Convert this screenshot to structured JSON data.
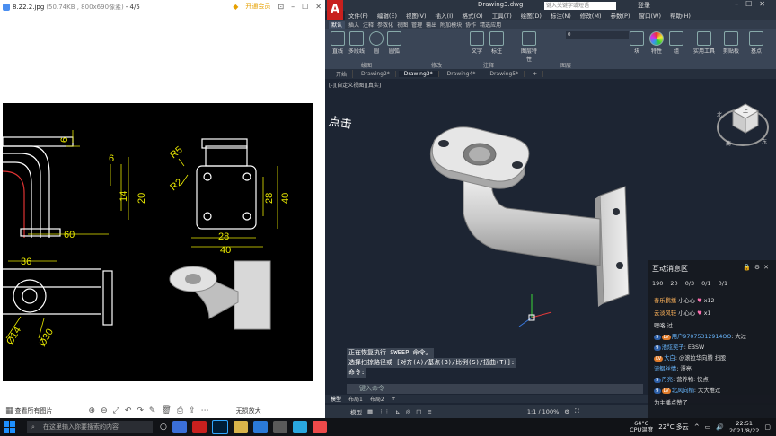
{
  "viewer": {
    "filename": "8.22.2.jpg",
    "meta": "(50.74KB , 800x690像素)",
    "page_counter": "- 4/5",
    "vip_label": "开通会员",
    "bottom_label": "查看所有图片",
    "bottom_right": "无损放大"
  },
  "drawing": {
    "dims": [
      "6",
      "6",
      "14",
      "20",
      "60",
      "R5",
      "R2",
      "28",
      "40",
      "28",
      "40",
      "36",
      "Ø14",
      "Ø30"
    ]
  },
  "acad": {
    "logo": "A",
    "doc_name": "Drawing3.dwg",
    "search_placeholder": "键入关键字或短语",
    "login": "登录",
    "menu": [
      "文件(F)",
      "编辑(E)",
      "视图(V)",
      "插入(I)",
      "格式(O)",
      "工具(T)",
      "绘图(D)",
      "标注(N)",
      "修改(M)",
      "参数(P)",
      "窗口(W)",
      "帮助(H)"
    ],
    "ribbon_tabs": [
      "默认",
      "插入",
      "注释",
      "参数化",
      "视图",
      "管理",
      "输出",
      "附加模块",
      "协作",
      "精选应用"
    ],
    "ribbon_buttons": [
      "直线",
      "多段线",
      "圆",
      "圆弧",
      "文字",
      "标注",
      "图层特性",
      "块",
      "特性",
      "组",
      "实用工具",
      "剪贴板",
      "基点"
    ],
    "ribbon_groups": [
      "绘图",
      "修改",
      "注释",
      "图层"
    ],
    "layer_value": "0",
    "doc_tabs": [
      "开始",
      "Drawing2*",
      "Drawing3*",
      "Drawing4*",
      "Drawing5*"
    ],
    "viewport_label": "[-][自定义视图][真实]",
    "handwritten": "点击",
    "viewcube": {
      "top": "上",
      "north": "北",
      "south": "南",
      "east": "东"
    },
    "command_history": [
      "正在恢复执行 SWEEP 命令。",
      "选择扫掠路径或 [对齐(A)/基点(B)/比例(S)/扭曲(T)]:",
      "命令:"
    ],
    "command_placeholder": "键入命令",
    "layout_tabs": [
      "模型",
      "布局1",
      "布局2"
    ],
    "status": [
      "模型",
      "1:1 / 100%"
    ]
  },
  "chat": {
    "title": "互动消息区",
    "stats": [
      "190",
      "20",
      "0/3",
      "0/1",
      "0/1"
    ],
    "lines": [
      {
        "user": "春乐鹏播",
        "text": "小心心",
        "extra": "x12"
      },
      {
        "user": "云淡风轻",
        "text": "小心心",
        "extra": "x1"
      },
      {
        "user": "",
        "text": "嗯咯 过"
      },
      {
        "user": "用户97075312914OO",
        "text": "大过"
      },
      {
        "user": "池炫奕子",
        "text": "EBSW"
      },
      {
        "user": "大白",
        "text": "@滚拉华向腾 扫股"
      },
      {
        "user": "流鲳丝情",
        "text": "漂亮"
      },
      {
        "user": "丹亮",
        "text": "营养物: 快点"
      },
      {
        "user": "北风向楠",
        "text": "大大推过"
      },
      {
        "user": "",
        "text": "为主播点赞了"
      }
    ]
  },
  "taskbar": {
    "search_placeholder": "在这里输入你要搜索的内容",
    "temp": "64°C",
    "temp_label": "CPU温度",
    "weather": "22°C 多云",
    "time": "22:51",
    "date": "2021/8/22"
  }
}
